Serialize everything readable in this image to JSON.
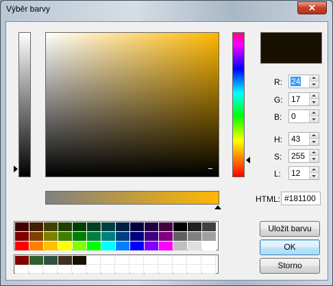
{
  "window": {
    "title": "Výběr barvy",
    "close_glyph": "✕"
  },
  "current_color": "#181100",
  "picker": {
    "hue_color": "#ffb700"
  },
  "fields": {
    "r": {
      "label": "R:",
      "value": "24"
    },
    "g": {
      "label": "G:",
      "value": "17"
    },
    "b": {
      "label": "B:",
      "value": "0"
    },
    "h": {
      "label": "H:",
      "value": "43"
    },
    "s": {
      "label": "S:",
      "value": "255"
    },
    "l": {
      "label": "L:",
      "value": "12"
    }
  },
  "html": {
    "label": "HTML:",
    "value": "#181100"
  },
  "buttons": {
    "save": "Uložit barvu",
    "ok": "OK",
    "cancel": "Storno"
  },
  "palette": [
    "#400000",
    "#402000",
    "#404000",
    "#204000",
    "#004000",
    "#004020",
    "#004040",
    "#002040",
    "#000040",
    "#200040",
    "#400040",
    "#000000",
    "#202020",
    "#404040",
    "#800000",
    "#804000",
    "#808000",
    "#408000",
    "#008000",
    "#008040",
    "#008080",
    "#004080",
    "#000080",
    "#400080",
    "#800080",
    "#606060",
    "#808080",
    "#a0a0a0",
    "#ff0000",
    "#ff8000",
    "#ffc000",
    "#ffff00",
    "#80ff00",
    "#00ff00",
    "#00ffff",
    "#0080ff",
    "#0000ff",
    "#8000ff",
    "#ff00ff",
    "#c0c0c0",
    "#e0e0e0",
    "#ffffff"
  ],
  "custom_colors": [
    "#800000",
    "#306030",
    "#305040",
    "#403020",
    "#181100",
    "",
    "",
    "",
    "",
    "",
    "",
    "",
    "",
    "",
    "",
    "",
    "",
    "",
    "",
    "",
    "",
    "",
    "",
    "",
    "",
    "",
    "",
    ""
  ]
}
